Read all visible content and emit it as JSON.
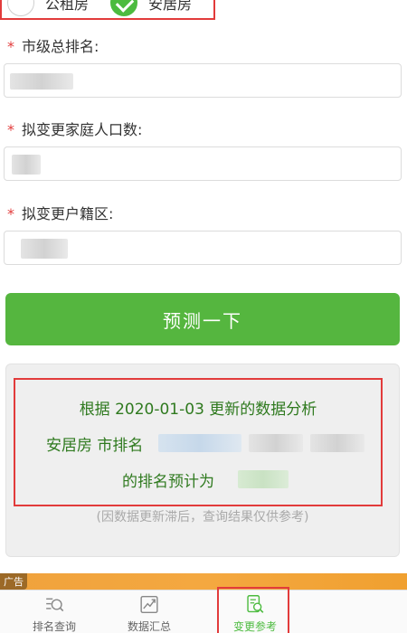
{
  "radio_group": {
    "options": [
      {
        "label": "公租房",
        "checked": false
      },
      {
        "label": "安居房",
        "checked": true
      }
    ]
  },
  "form": {
    "fields": [
      {
        "required_mark": "*",
        "label": "市级总排名:"
      },
      {
        "required_mark": "*",
        "label": "拟变更家庭人口数:"
      },
      {
        "required_mark": "*",
        "label": "拟变更户籍区:"
      }
    ],
    "submit_label": "预测一下"
  },
  "result": {
    "line1": "根据 2020-01-03 更新的数据分析",
    "line2_prefix": "安居房 市排名",
    "line3_prefix": "的排名预计为",
    "note": "(因数据更新滞后，查询结果仅供参考)"
  },
  "ad": {
    "tag": "广告"
  },
  "tabbar": {
    "tabs": [
      {
        "label": "排名查询",
        "icon": "search-list-icon",
        "active": false
      },
      {
        "label": "数据汇总",
        "icon": "chart-icon",
        "active": false
      },
      {
        "label": "变更参考",
        "icon": "document-search-icon",
        "active": true
      }
    ]
  },
  "colors": {
    "primary_green": "#55b63f",
    "highlight_red": "#e23b3b",
    "result_text": "#2f7a1f"
  }
}
